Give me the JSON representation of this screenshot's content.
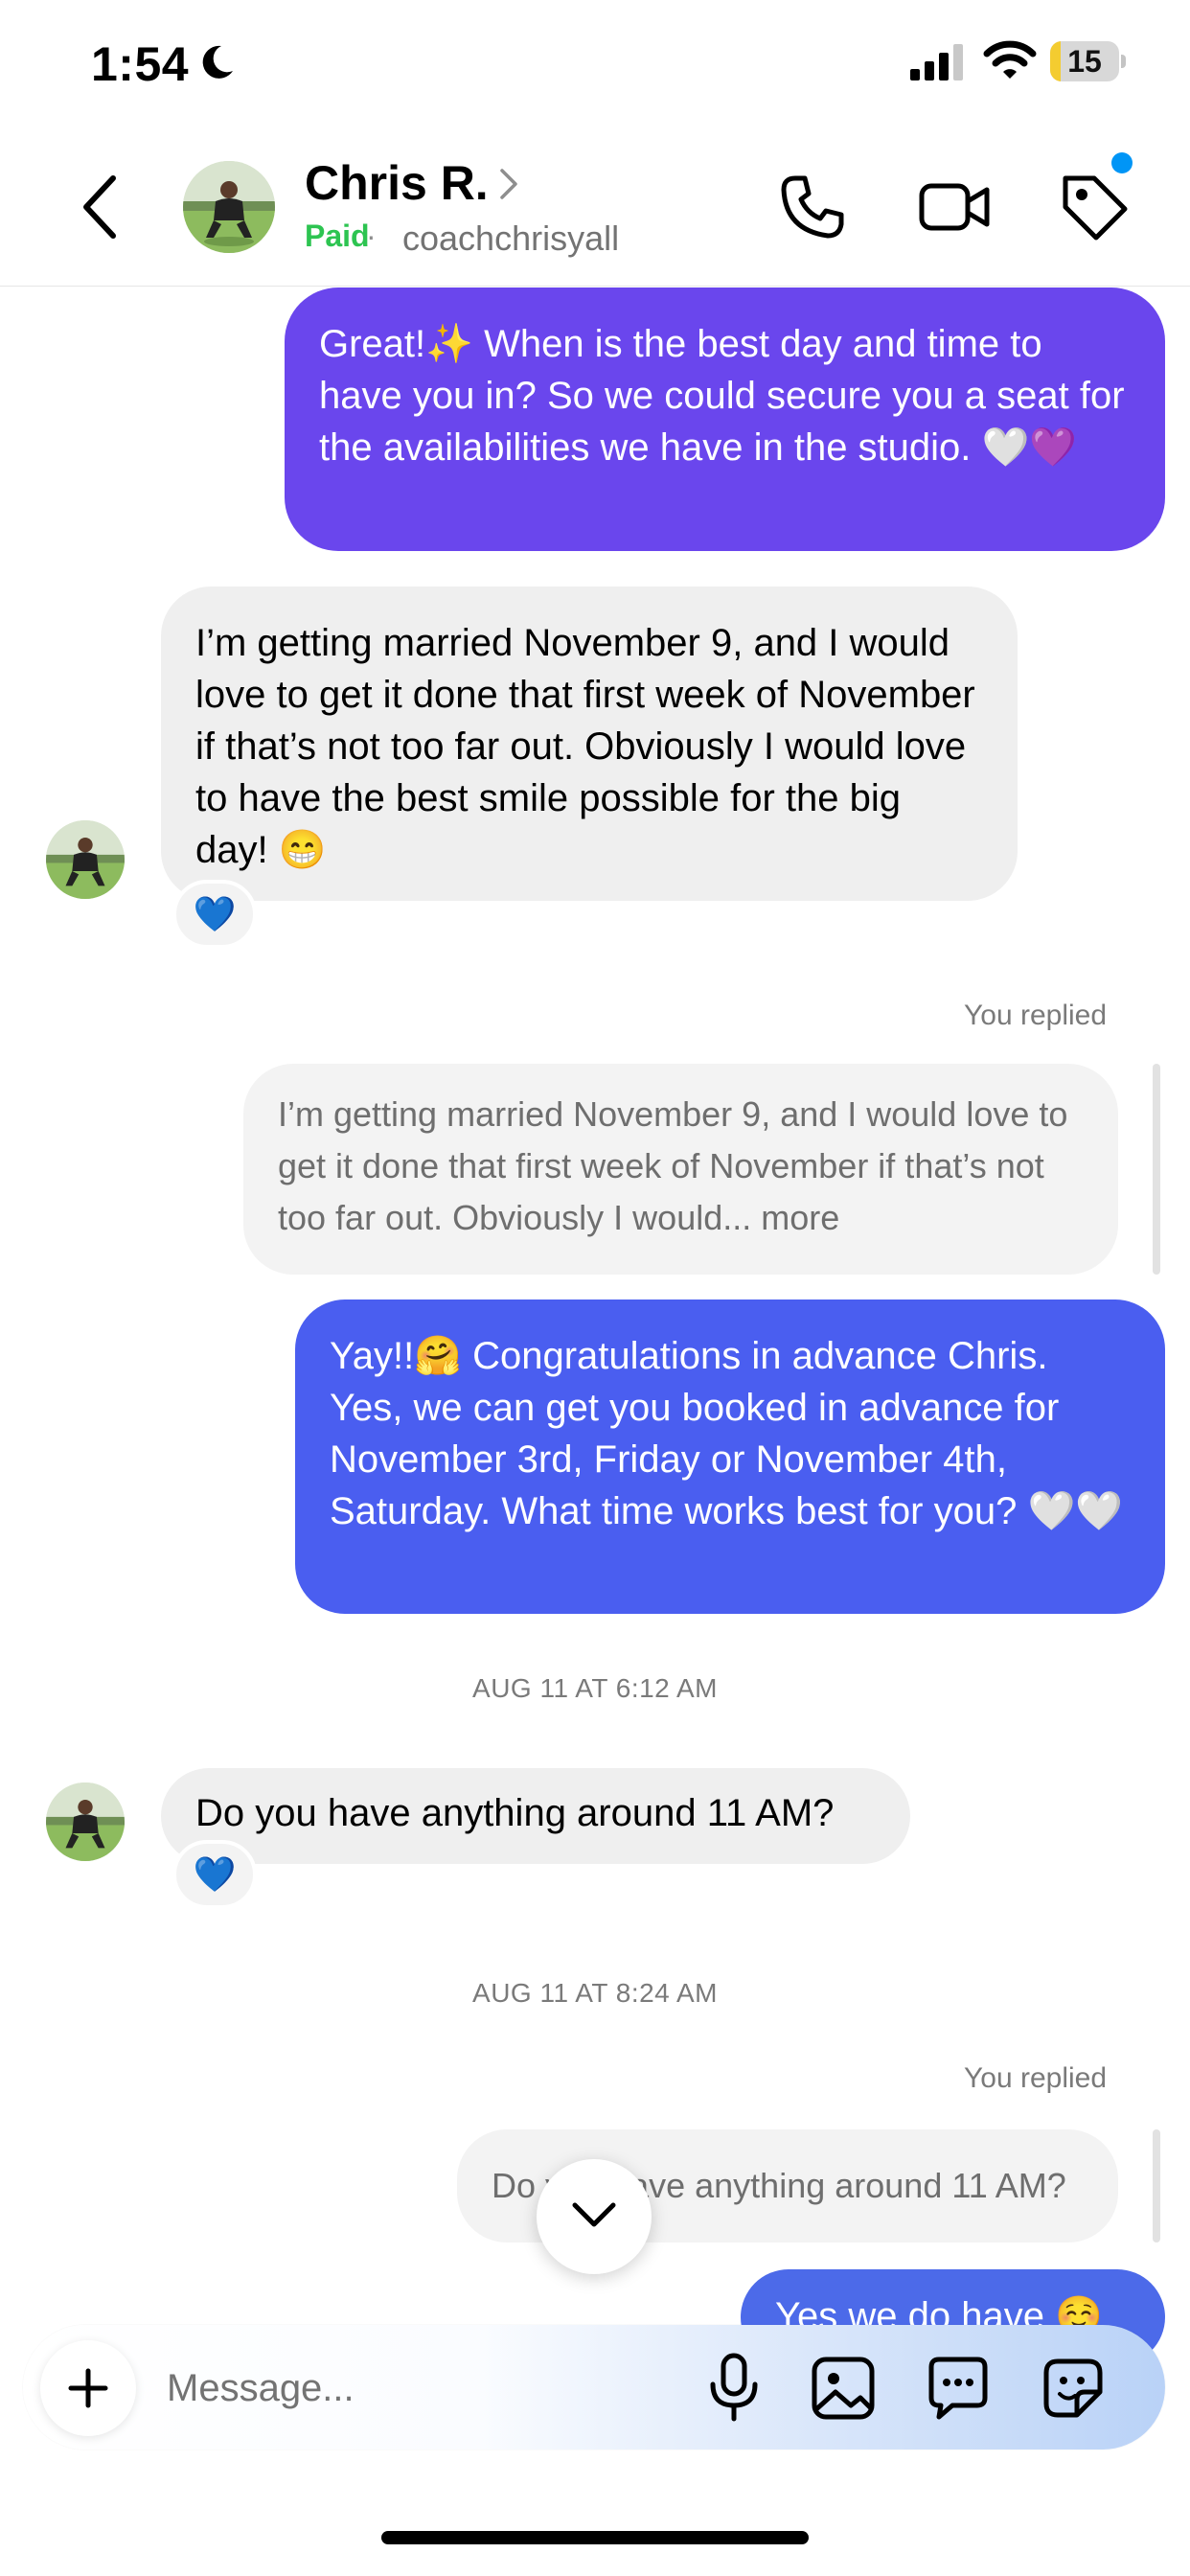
{
  "status_bar": {
    "time": "1:54",
    "battery": "15",
    "battery_level": 0.15
  },
  "header": {
    "name": "Chris R.",
    "paid_label": "Paid",
    "separator": "·",
    "username": "coachchrisyall"
  },
  "messages": {
    "m1": "Great!✨ When is the best day and time to have you in? So we could secure you a seat for the availabilities we have in the studio. 🤍💜",
    "m2": "I’m getting married November 9, and I would love to get it done that first week of November if that’s not too far out. Obviously I would love to have the best smile possible for the big day!  😁",
    "m2_reaction": "💙",
    "replied_label_1": "You replied",
    "quote_1": "I’m getting married November 9, and I would love to get it done that first week of November if that’s not too far out. Obviously I would... more",
    "m4": "Yay!!🤗 Congratulations in advance Chris. Yes, we can get you booked in advance for November 3rd, Friday or November 4th, Saturday. What time works best for you? 🤍🤍",
    "timestamp_1": "AUG 11 AT 6:12 AM",
    "m5": "Do you have anything around 11 AM?",
    "m5_reaction": "💙",
    "timestamp_2": "AUG 11 AT 8:24 AM",
    "replied_label_2": "You replied",
    "quote_2": "Do you have anything around 11 AM?",
    "m6": "Yes we do have ☺️"
  },
  "composer": {
    "placeholder": "Message..."
  },
  "colors": {
    "bubble_purple": "#6a46ed",
    "bubble_blue": "#4a5ef0",
    "paid_green": "#2dc451",
    "notification_blue": "#0095f6"
  },
  "icons": [
    "moon-icon",
    "signal-icon",
    "wifi-icon",
    "battery-icon",
    "back-chevron-icon",
    "chevron-right-icon",
    "phone-icon",
    "video-camera-icon",
    "tag-icon",
    "chevron-down-icon",
    "plus-icon",
    "microphone-icon",
    "gallery-icon",
    "chat-bubble-icon",
    "sticker-icon"
  ]
}
